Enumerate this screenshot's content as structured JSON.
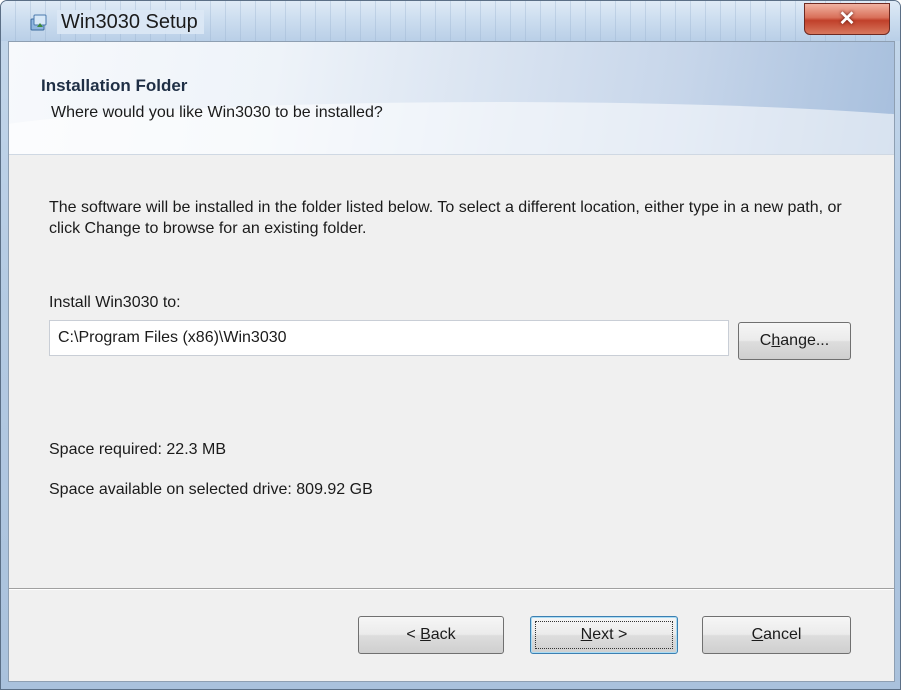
{
  "window": {
    "title": "Win3030 Setup",
    "close_glyph": "✕",
    "icon": "setup-installer-icon"
  },
  "banner": {
    "title": "Installation Folder",
    "subtitle": "Where would you like Win3030 to be installed?"
  },
  "body": {
    "description": "The software will be installed in the folder listed below. To select a different location, either type in a new path, or click Change to browse for an existing folder.",
    "install_label": "Install Win3030 to:",
    "install_path": "C:\\Program Files (x86)\\Win3030",
    "space_required": "Space required: 22.3 MB",
    "space_available": "Space available on selected drive: 809.92 GB"
  },
  "buttons": {
    "change": {
      "pre": "C",
      "accel": "h",
      "post": "ange..."
    },
    "back": {
      "pre": "< ",
      "accel": "B",
      "post": "ack"
    },
    "next": {
      "pre": "",
      "accel": "N",
      "post": "ext >"
    },
    "cancel": {
      "pre": "",
      "accel": "C",
      "post": "ancel"
    }
  },
  "colors": {
    "close_red": "#c0402a",
    "default_button_border": "#3c7fb1"
  }
}
